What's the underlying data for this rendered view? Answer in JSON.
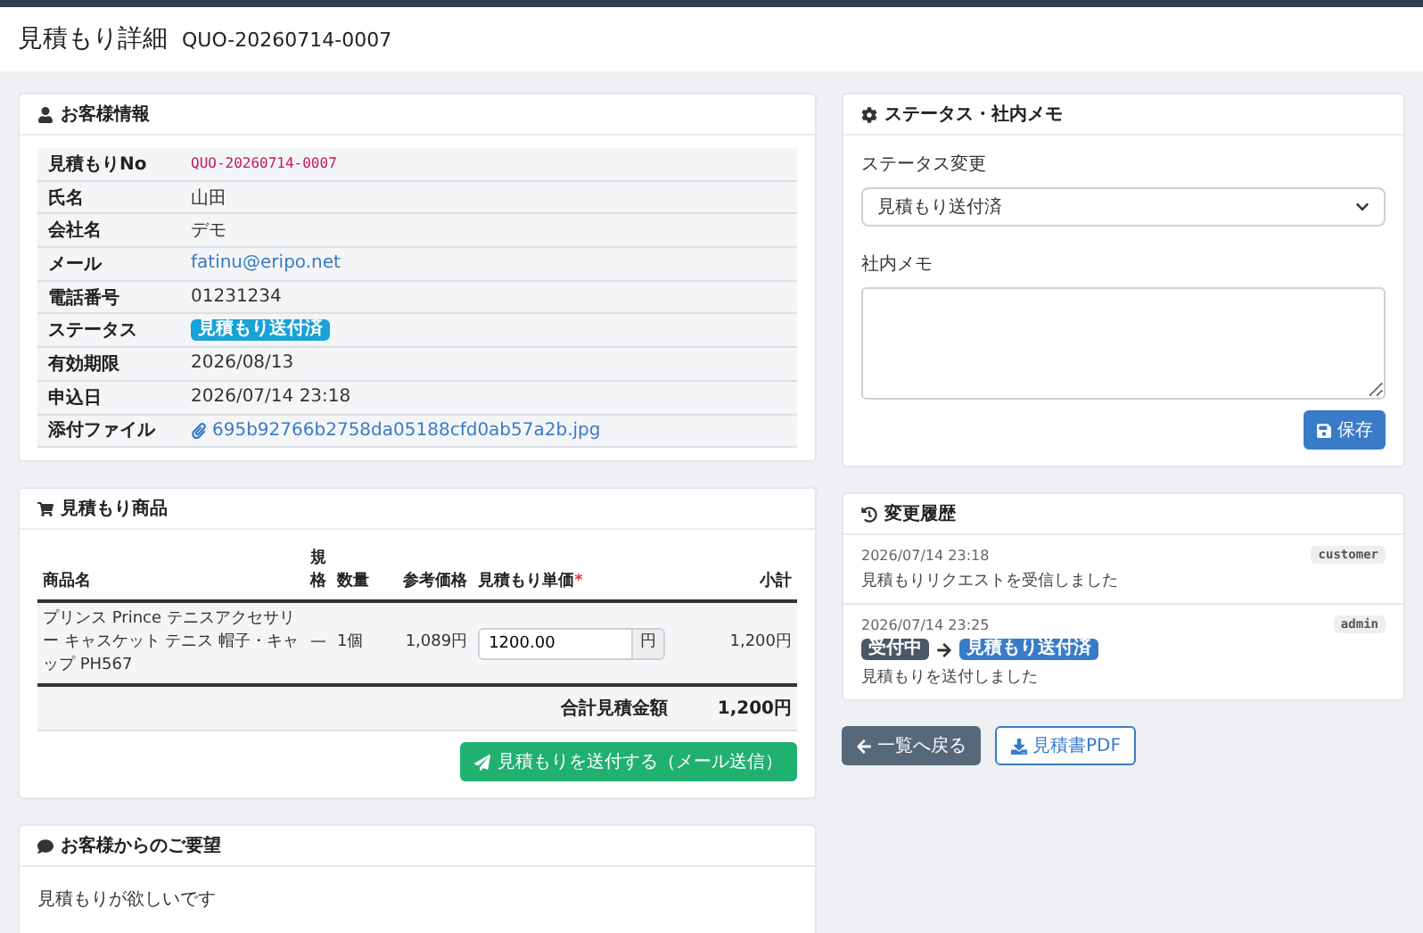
{
  "header": {
    "title": "見積もり詳細",
    "quote_no": "QUO-20260714-0007"
  },
  "customer_card": {
    "title": "お客様情報",
    "rows": [
      {
        "label": "見積もりNo",
        "value": "QUO-20260714-0007",
        "kind": "code"
      },
      {
        "label": "氏名",
        "value": "山田",
        "kind": "text"
      },
      {
        "label": "会社名",
        "value": "デモ",
        "kind": "text"
      },
      {
        "label": "メール",
        "value": "fatinu@eripo.net",
        "kind": "link"
      },
      {
        "label": "電話番号",
        "value": "01231234",
        "kind": "text"
      },
      {
        "label": "ステータス",
        "value": "見積もり送付済",
        "kind": "badge"
      },
      {
        "label": "有効期限",
        "value": "2026/08/13",
        "kind": "text"
      },
      {
        "label": "申込日",
        "value": "2026/07/14 23:18",
        "kind": "text"
      },
      {
        "label": "添付ファイル",
        "value": "695b92766b2758da05188cfd0ab57a2b.jpg",
        "kind": "file"
      }
    ]
  },
  "items_card": {
    "title": "見積もり商品",
    "columns": [
      {
        "label": "商品名"
      },
      {
        "label": "規格"
      },
      {
        "label": "数量"
      },
      {
        "label": "参考価格"
      },
      {
        "label": "見積もり単価",
        "marker": "*"
      },
      {
        "label": "小計"
      }
    ],
    "rows": [
      {
        "name": "プリンス Prince テニスアクセサリー キャスケット テニス 帽子・キャップ PH567",
        "spec": "—",
        "qty": "1個",
        "ref_price": "1,089円",
        "unit_price": "1200.00",
        "unit": "円",
        "subtotal": "1,200円"
      }
    ],
    "total_label": "合計見積金額",
    "total": "1,200円",
    "send_button": "見積もりを送付する（メール送信）"
  },
  "request_card": {
    "title": "お客様からのご要望",
    "body": "見積もりが欲しいです"
  },
  "status_card": {
    "title": "ステータス・社内メモ",
    "status_label": "ステータス変更",
    "status_value": "見積もり送付済",
    "memo_label": "社内メモ",
    "save_button": "保存"
  },
  "history_card": {
    "title": "変更履歴",
    "entries": [
      {
        "time": "2026/07/14 23:18",
        "user": "customer",
        "message": "見積もりリクエストを受信しました"
      },
      {
        "time": "2026/07/14 23:25",
        "user": "admin",
        "status_from": "受付中",
        "status_to": "見積もり送付済",
        "message": "見積もりを送付しました"
      }
    ]
  },
  "buttons": {
    "back": "一覧へ戻る",
    "pdf": "見積書PDF"
  }
}
